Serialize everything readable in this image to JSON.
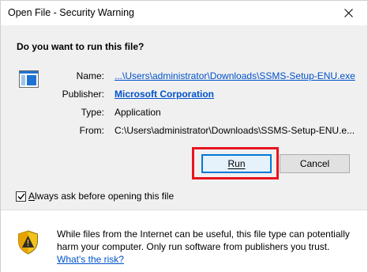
{
  "window": {
    "title": "Open File - Security Warning"
  },
  "dialog": {
    "question": "Do you want to run this file?",
    "fields": {
      "name_label": "Name:",
      "name_value": "...\\Users\\administrator\\Downloads\\SSMS-Setup-ENU.exe",
      "publisher_label": "Publisher:",
      "publisher_value": "Microsoft Corporation",
      "type_label": "Type:",
      "type_value": "Application",
      "from_label": "From:",
      "from_value": "C:\\Users\\administrator\\Downloads\\SSMS-Setup-ENU.e..."
    },
    "buttons": {
      "run": "Run",
      "cancel": "Cancel"
    },
    "checkbox": {
      "label": "lways ask before opening this file",
      "mnemonic": "A",
      "checked": true
    }
  },
  "footer": {
    "warning": "While files from the Internet can be useful, this file type can potentially harm your computer. Only run software from publishers you trust.",
    "link": "What's the risk?"
  },
  "icons": {
    "close": "close-icon",
    "file": "application-file-icon",
    "shield": "shield-warning-icon",
    "check": "check-icon"
  },
  "colors": {
    "accent": "#0078d7",
    "link": "#0052cc",
    "highlight": "#e8141f",
    "panel": "#f0f0f0"
  }
}
